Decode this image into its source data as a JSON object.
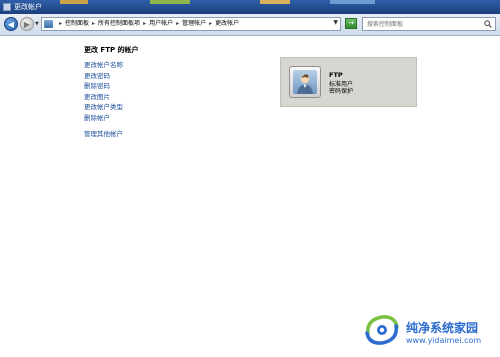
{
  "window": {
    "title": "更改帐户"
  },
  "address_bar": {
    "crumbs": [
      "控制面板",
      "所有控制面板项",
      "用户帐户",
      "管理帐户",
      "更改帐户"
    ]
  },
  "search": {
    "placeholder": "搜索控制面板"
  },
  "main": {
    "heading": "更改 FTP 的帐户",
    "links": [
      "更改帐户名称",
      "更改密码",
      "删除密码",
      "更改图片",
      "更改帐户类型",
      "删除帐户"
    ],
    "manage_link": "管理其他帐户"
  },
  "account_card": {
    "name": "FTP",
    "type": "标准用户",
    "status": "密码保护"
  },
  "watermark": {
    "text": "纯净系统家园",
    "url": "www.yidaimei.com"
  },
  "colors": {
    "title_bar": "#2f5fa8",
    "link": "#1a4d9a",
    "card_bg": "#d8d6d0",
    "watermark": "#2d6dd0"
  },
  "icons": [
    "window-icon",
    "back-arrow-icon",
    "forward-arrow-icon",
    "control-panel-icon",
    "refresh-icon",
    "search-icon",
    "user-avatar-icon",
    "watermark-logo-icon"
  ]
}
